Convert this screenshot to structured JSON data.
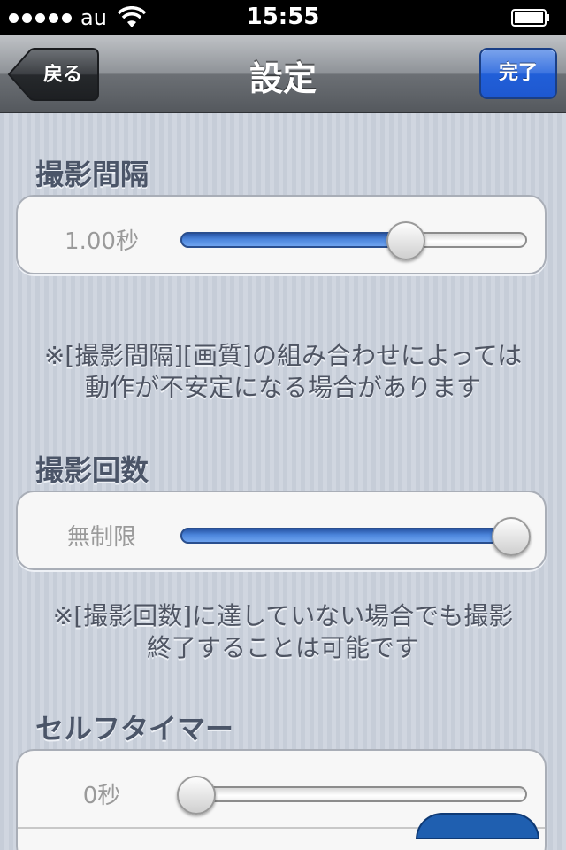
{
  "status_bar": {
    "carrier": "au",
    "time": "15:55"
  },
  "nav": {
    "title": "設定",
    "back_label": "戻る",
    "done_label": "完了"
  },
  "sections": {
    "interval": {
      "header": "撮影間隔",
      "value": "1.00秒",
      "slider_fraction": 0.65,
      "note_line1": "※[撮影間隔][画質]の組み合わせによっては",
      "note_line2": "動作が不安定になる場合があります"
    },
    "count": {
      "header": "撮影回数",
      "value": "無制限",
      "slider_fraction": 1.0,
      "note_line1": "※[撮影回数]に達していない場合でも撮影",
      "note_line2": "終了することは可能です"
    },
    "timer": {
      "header": "セルフタイマー",
      "value": "0秒",
      "slider_fraction": 0.0
    }
  },
  "colors": {
    "nav_accent": "#215fd8",
    "slider_fill": "#4c86dc",
    "header_text": "#4b5568"
  }
}
